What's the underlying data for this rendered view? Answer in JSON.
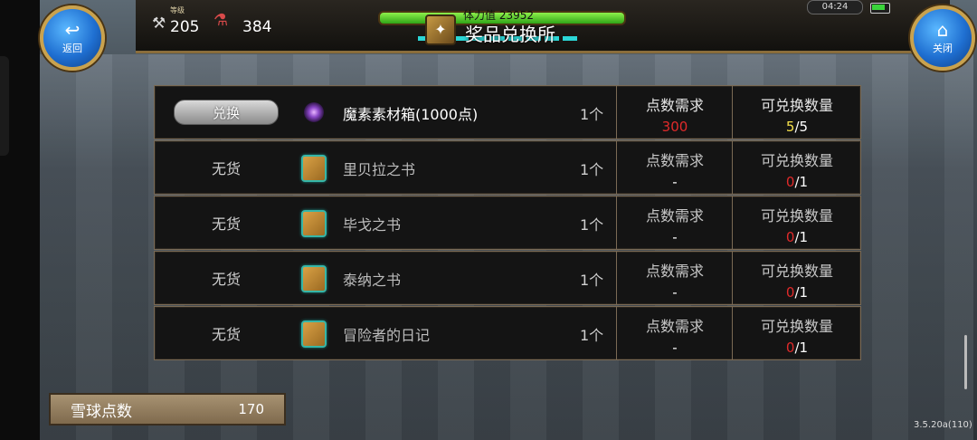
{
  "header": {
    "back_label": "返回",
    "close_label": "关闭",
    "level_caption": "等级",
    "level": "205",
    "potion_count": "384",
    "hp_text": "体力值 23952",
    "title": "奖品兑换所",
    "clock": "04:24"
  },
  "rows": [
    {
      "action": "兑换",
      "action_type": "button",
      "icon": "purple-orb-icon",
      "name": "魔素素材箱(1000点)",
      "qty": "1个",
      "points_label": "点数需求",
      "points_value": "300",
      "count_label": "可兑换数量",
      "count_have": "5",
      "count_sep_total": "/5"
    },
    {
      "action": "无货",
      "action_type": "text",
      "icon": "book-icon",
      "name": "里贝拉之书",
      "qty": "1个",
      "points_label": "点数需求",
      "points_value": "-",
      "count_label": "可兑换数量",
      "count_have": "0",
      "count_sep_total": "/1"
    },
    {
      "action": "无货",
      "action_type": "text",
      "icon": "book-icon",
      "name": "毕戈之书",
      "qty": "1个",
      "points_label": "点数需求",
      "points_value": "-",
      "count_label": "可兑换数量",
      "count_have": "0",
      "count_sep_total": "/1"
    },
    {
      "action": "无货",
      "action_type": "text",
      "icon": "book-icon",
      "name": "泰纳之书",
      "qty": "1个",
      "points_label": "点数需求",
      "points_value": "-",
      "count_label": "可兑换数量",
      "count_have": "0",
      "count_sep_total": "/1"
    },
    {
      "action": "无货",
      "action_type": "text",
      "icon": "book-icon",
      "name": "冒险者的日记",
      "qty": "1个",
      "points_label": "点数需求",
      "points_value": "-",
      "count_label": "可兑换数量",
      "count_have": "0",
      "count_sep_total": "/1"
    }
  ],
  "footer": {
    "points_label": "雪球点数",
    "points_value": "170",
    "version": "3.5.20a(110)"
  },
  "colors": {
    "accent_gold": "#c9a24e",
    "red": "#e02a2a",
    "yellow": "#f5e04b",
    "hp_green": "#2fa517"
  }
}
